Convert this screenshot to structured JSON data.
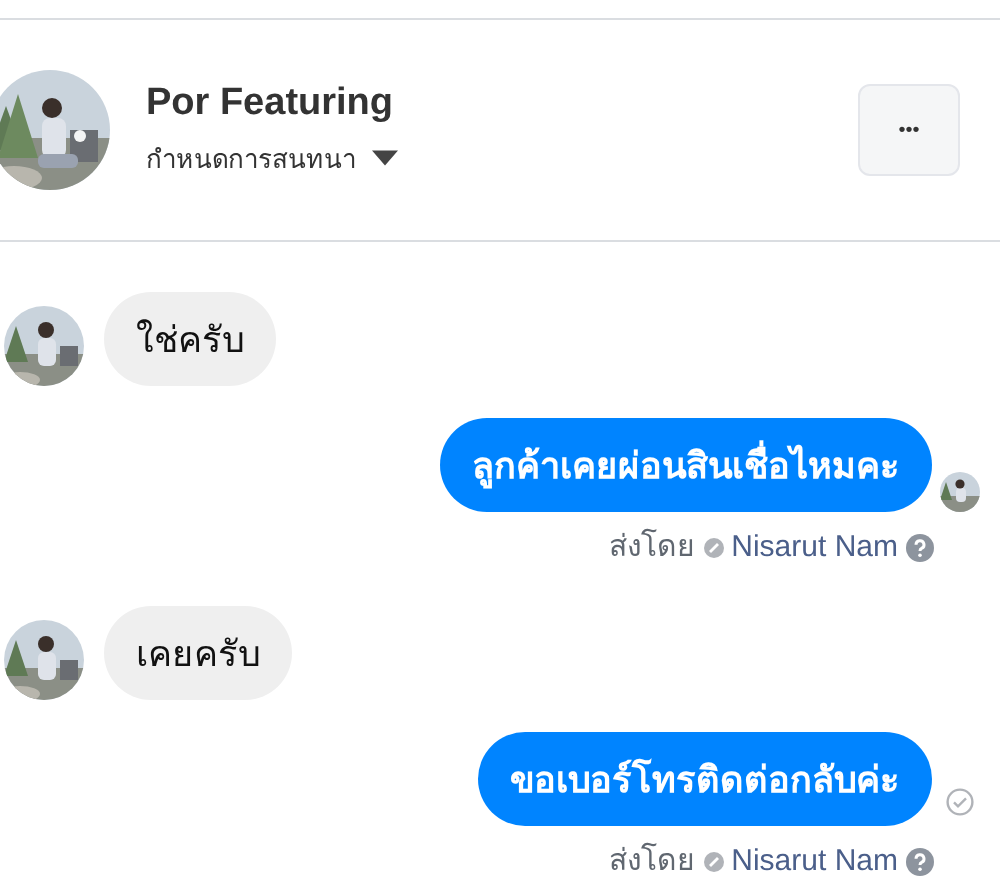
{
  "conversation": {
    "name": "Por Featuring",
    "subtitle": "กำหนดการสนทนา",
    "more_button": "•••"
  },
  "messages": [
    {
      "kind": "received",
      "text": "ใช่ครับ"
    },
    {
      "kind": "sent",
      "text": "ลูกค้าเคยผ่อนสินเชื่อไหมคะ",
      "seen": true
    },
    {
      "kind": "sent_by",
      "label": "ส่งโดย",
      "name": "Nisarut Nam"
    },
    {
      "kind": "received",
      "text": "เคยครับ"
    },
    {
      "kind": "sent",
      "text": "ขอเบอร์โทรติดต่อกลับค่ะ",
      "seen": false
    },
    {
      "kind": "sent_by",
      "label": "ส่งโดย",
      "name": "Nisarut Nam"
    }
  ]
}
